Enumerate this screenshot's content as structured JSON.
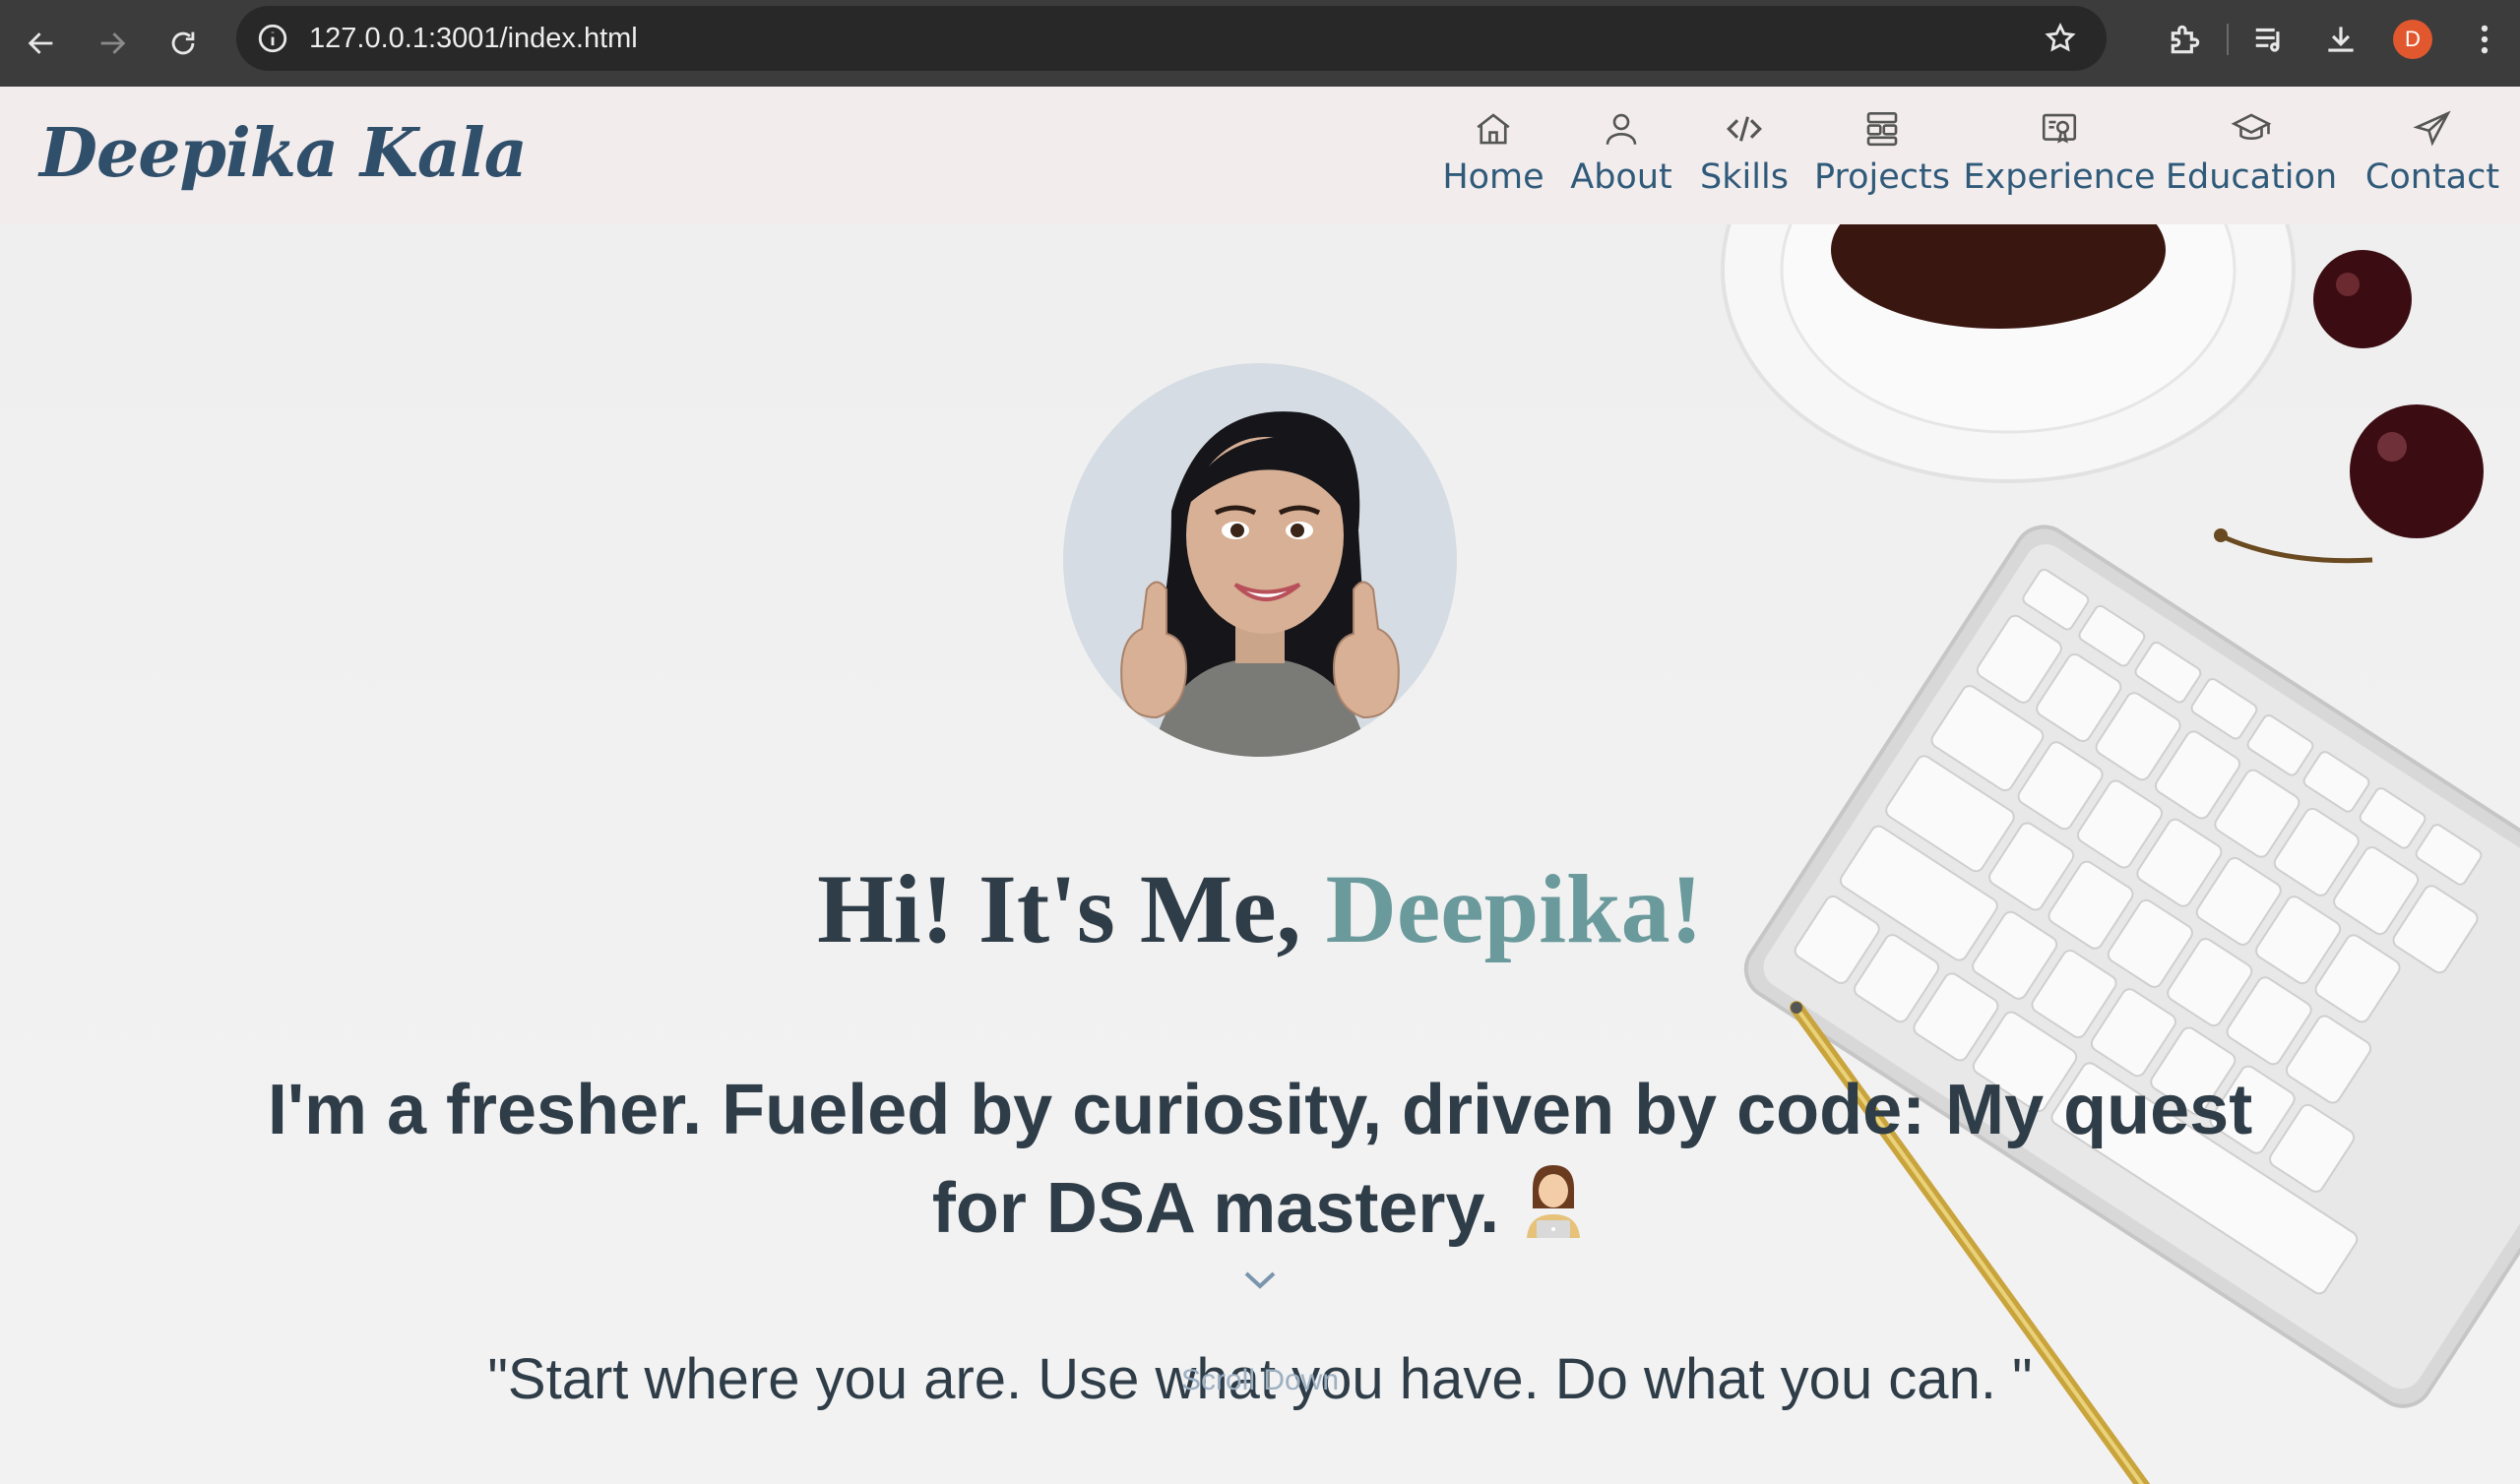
{
  "browser": {
    "url": "127.0.0.1:3001/index.html",
    "profile_initial": "D"
  },
  "site": {
    "logo": "Deepika Kala",
    "nav": [
      {
        "label": "Home",
        "icon": "home-icon"
      },
      {
        "label": "About",
        "icon": "user-icon"
      },
      {
        "label": "Skills",
        "icon": "code-icon"
      },
      {
        "label": "Projects",
        "icon": "projects-icon"
      },
      {
        "label": "Experience",
        "icon": "certificate-icon"
      },
      {
        "label": "Education",
        "icon": "graduation-cap-icon"
      },
      {
        "label": "Contact",
        "icon": "paper-plane-icon"
      }
    ]
  },
  "hero": {
    "title_prefix": "Hi! It's Me, ",
    "title_name": "Deepika!",
    "tagline": "I'm a fresher. Fueled by curiosity, driven by code: My quest for DSA mastery.",
    "quote": "\"Start where you are. Use what you have. Do what you can. \"",
    "scroll_label": "Scroll Down"
  },
  "colors": {
    "header_bg": "#f3ecec",
    "nav_text": "#2f5a7a",
    "heading": "#2f3d48",
    "name_accent": "#6a9a9c"
  }
}
